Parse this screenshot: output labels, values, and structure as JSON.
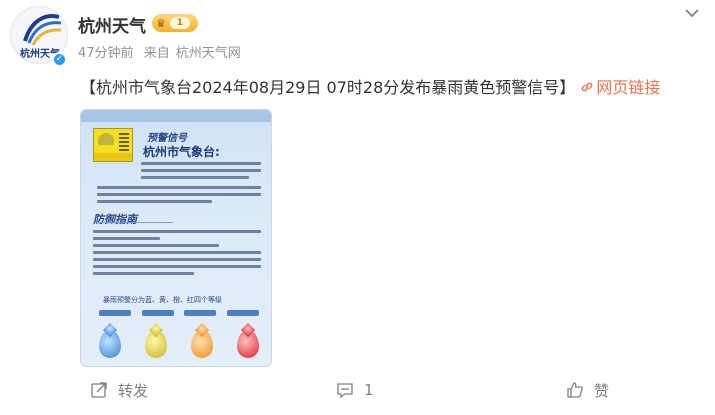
{
  "header": {
    "username": "杭州天气",
    "vip_level": "1",
    "time": "47分钟前",
    "source_prefix": "来自",
    "source": "杭州天气网",
    "avatar_text": "杭州天气"
  },
  "post": {
    "text": "【杭州市气象台2024年08月29日 07时28分发布暴雨黄色预警信号】",
    "link_label": "网页链接"
  },
  "image": {
    "section1_title": "预警信号",
    "bureau": "杭州市气象台:",
    "section2_title": "防御指南",
    "levels_title": "暴雨预警分为蓝、黄、橙、红四个等级",
    "colors": {
      "blue": "#3a7fd0",
      "yellow": "#c9b21a",
      "orange": "#f08a1a",
      "red": "#d9202a"
    }
  },
  "actions": {
    "repost_label": "转发",
    "comment_count": "1",
    "like_label": "赞"
  },
  "colors": {
    "link": "#eb7350",
    "meta": "#939393",
    "text": "#333333"
  }
}
